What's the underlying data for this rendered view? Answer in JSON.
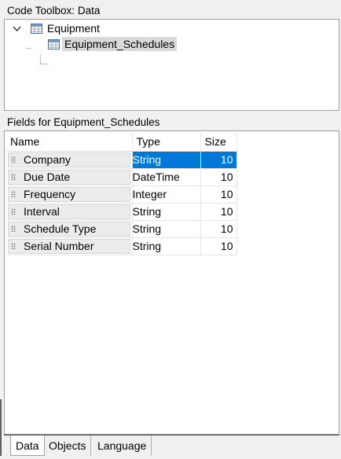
{
  "toolbox": {
    "title": "Code Toolbox: Data"
  },
  "tree": {
    "root": {
      "label": "Equipment",
      "icon": "table-icon",
      "expanded": true
    },
    "child": {
      "label": "Equipment_Schedules",
      "icon": "table-icon",
      "selected": true
    }
  },
  "fields": {
    "title": "Fields for Equipment_Schedules",
    "columns": [
      "Name",
      "Type",
      "Size"
    ],
    "rows": [
      {
        "name": "Company",
        "type": "String",
        "size": "10",
        "selected": true
      },
      {
        "name": "Due Date",
        "type": "DateTime",
        "size": "10"
      },
      {
        "name": "Frequency",
        "type": "Integer",
        "size": "10"
      },
      {
        "name": "Interval",
        "type": "String",
        "size": "10"
      },
      {
        "name": "Schedule Type",
        "type": "String",
        "size": "10"
      },
      {
        "name": "Serial Number",
        "type": "String",
        "size": "10"
      }
    ]
  },
  "tabs": [
    "Data",
    "Objects",
    "Language"
  ],
  "active_tab": "Data",
  "colors": {
    "selection": "#0078d7",
    "tree_selection": "#d9d9d9"
  }
}
